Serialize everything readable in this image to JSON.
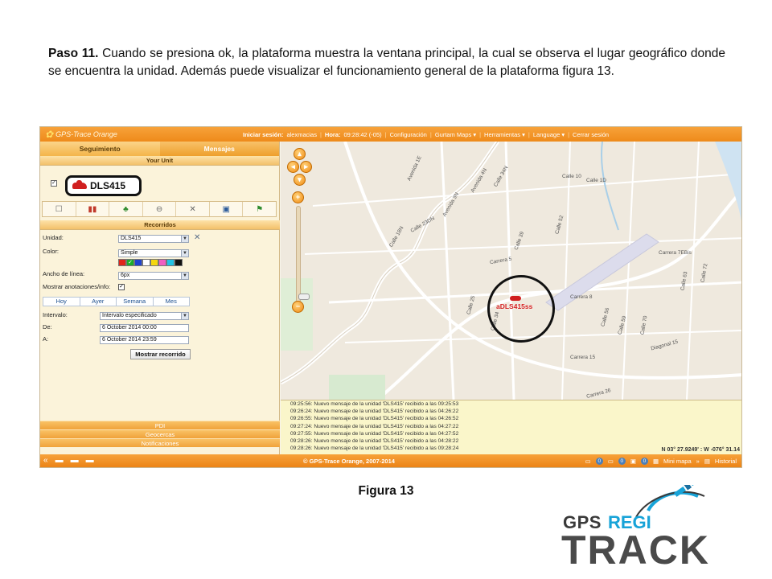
{
  "document": {
    "step_label": "Paso 11.",
    "paragraph": " Cuando se presiona ok, la plataforma muestra la ventana principal, la cual se observa el lugar geográfico donde se encuentra la unidad. Además puede visualizar el funcionamiento general de la plataforma figura 13.",
    "caption": "Figura 13"
  },
  "app": {
    "logo_text": "GPS-Trace Orange",
    "topbar": {
      "login_label": "Iniciar sesión:",
      "user": "alexmacias",
      "hour_label": "Hora:",
      "hour_value": "09:28:42 (-05)",
      "menu": [
        "Configuración",
        "Gurtam Maps ▾",
        "Herramientas ▾",
        "Language ▾",
        "Cerrar sesión"
      ]
    },
    "tabs": [
      "Seguimiento",
      "Mensajes"
    ],
    "your_unit_heading": "Your Unit",
    "unit_name": "DLS415",
    "recorridos": {
      "heading": "Recorridos",
      "unidad_label": "Unidad:",
      "unidad_value": "DLS415",
      "color_label": "Color:",
      "color_value": "Simple",
      "swatch_colors": [
        "#e0261b",
        "#1cae2b",
        "#2043d0",
        "#ffffff",
        "#f6d70d",
        "#f15fc1",
        "#22c3e6",
        "#111111"
      ],
      "ancho_label": "Ancho de línea:",
      "ancho_value": "6px",
      "mostrar_label": "Mostrar anotaciones/info:",
      "mostrar_checked": true,
      "periods": [
        "Hoy",
        "Ayer",
        "Semana",
        "Mes"
      ],
      "intervalo_label": "Intervalo:",
      "intervalo_value": "Intervalo especificado",
      "de_label": "De:",
      "de_value": "6 October 2014 00:00",
      "a_label": "A:",
      "a_value": "6 October 2014 23:59",
      "button": "Mostrar recorrido"
    },
    "sidebar_footer": [
      "PDI",
      "Geocercas",
      "Notificaciones"
    ],
    "map": {
      "unit_label": "aDLS415ss",
      "streets": [
        "Avenida 1E",
        "Calle 23DN",
        "Calle 34N",
        "Calle 10",
        "Calle 1D",
        "Carrera 5",
        "Carrera 8",
        "Calle 39",
        "Calle 52",
        "Calle 25",
        "Calle 34",
        "Carrera 15",
        "Calle 56",
        "Calle 59",
        "Calle 70",
        "Diagonal 15",
        "Carrera 26",
        "Carrera 7EBis",
        "Calle 63",
        "Calle 72",
        "Avenida 3N",
        "Avenida 4N",
        "Calle 18N"
      ]
    },
    "log": [
      "09:25:56: Nuevo mensaje de la unidad 'DLS415' recibido a las 09:25:53",
      "09:26:24: Nuevo mensaje de la unidad 'DLS415' recibido a las 04:26:22",
      "09:26:55: Nuevo mensaje de la unidad 'DLS415' recibido a las 04:26:52",
      "09:27:24: Nuevo mensaje de la unidad 'DLS415' recibido a las 04:27:22",
      "09:27:55: Nuevo mensaje de la unidad 'DLS415' recibido a las 04:27:52",
      "09:28:26: Nuevo mensaje de la unidad 'DLS415' recibido a las 04:28:22",
      "09:28:26: Nuevo mensaje de la unidad 'DLS415' recibido a las 09:28:24"
    ],
    "coords": "N 03° 27.9249' : W -076° 31.14",
    "bottombar": {
      "copyright": "© GPS-Trace Orange, 2007-2014",
      "counters": [
        "0",
        "0",
        "0"
      ],
      "minimap": "Mini mapa",
      "historial": "Historial"
    }
  },
  "brand": {
    "gps": "GPS",
    "regi": "REGI",
    "track": "TRACK"
  }
}
